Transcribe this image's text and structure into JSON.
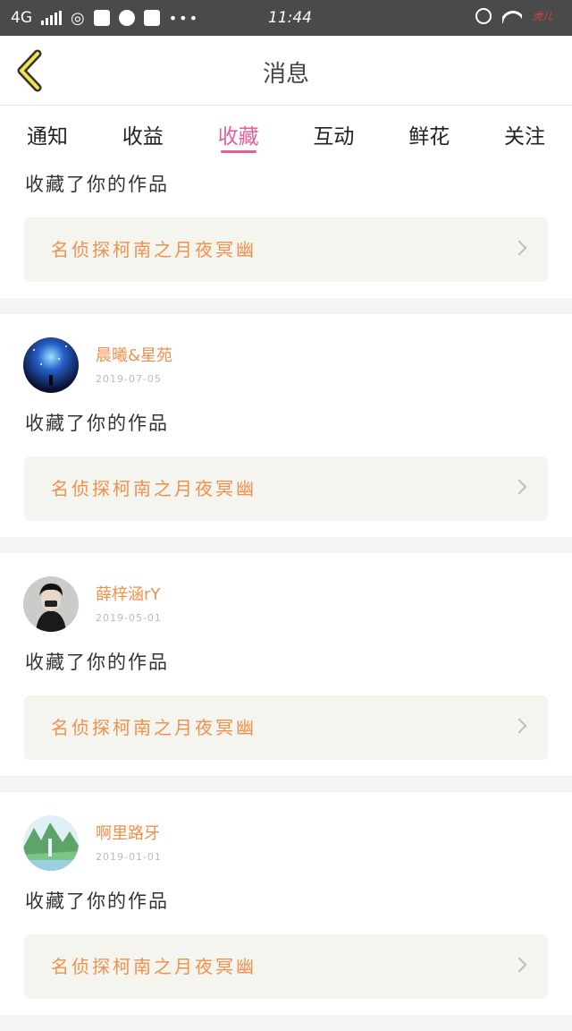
{
  "status_bar": {
    "network": "4G",
    "time": "11:44",
    "carrier_label": "虎儿"
  },
  "header": {
    "back_icon": "chevron-left-icon",
    "title": "消息"
  },
  "tabs": [
    {
      "label": "通知",
      "active": false
    },
    {
      "label": "收益",
      "active": false
    },
    {
      "label": "收藏",
      "active": true
    },
    {
      "label": "互动",
      "active": false
    },
    {
      "label": "鲜花",
      "active": false
    },
    {
      "label": "关注",
      "active": false
    }
  ],
  "feed": [
    {
      "user": null,
      "action": "收藏了你的作品",
      "work_title": "名侦探柯南之月夜冥幽"
    },
    {
      "user": {
        "name": "晨曦&星苑",
        "date": "2019-07-05",
        "avatar": "galaxy-avatar"
      },
      "action": "收藏了你的作品",
      "work_title": "名侦探柯南之月夜冥幽"
    },
    {
      "user": {
        "name": "薛梓涵rY",
        "date": "2019-05-01",
        "avatar": "portrait-avatar"
      },
      "action": "收藏了你的作品",
      "work_title": "名侦探柯南之月夜冥幽"
    },
    {
      "user": {
        "name": "啊里路牙",
        "date": "2019-01-01",
        "avatar": "landscape-avatar"
      },
      "action": "收藏了你的作品",
      "work_title": "名侦探柯南之月夜冥幽"
    }
  ],
  "colors": {
    "accent": "#e0609c",
    "name_color": "#f0904e",
    "status_bar": "#4a4a4a"
  }
}
